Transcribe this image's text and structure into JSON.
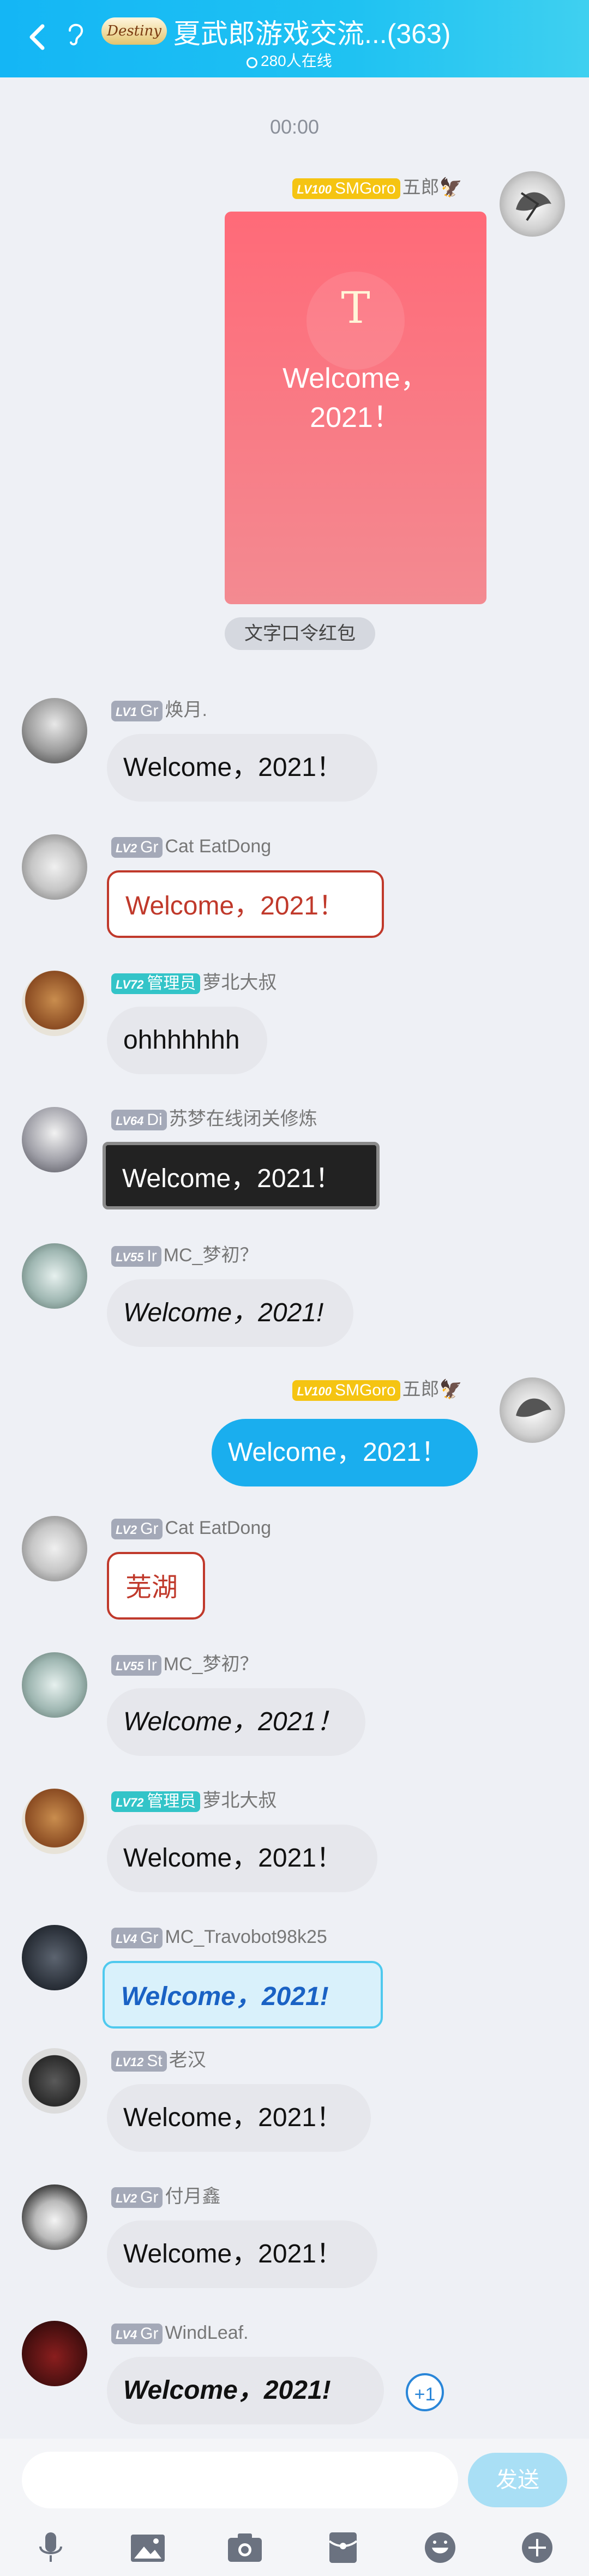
{
  "header": {
    "group_logo_text": "Destiny",
    "title": "夏武郎游戏交流...(363)",
    "online": "280人在线"
  },
  "time": "00:00",
  "owner_message": {
    "level": "LV100",
    "title_badge": "SMGoro",
    "name": "五郎",
    "envelope_icon_text": "T",
    "envelope_text_line1": "Welcome，",
    "envelope_text_line2": "2021！",
    "envelope_label": "文字口令红包"
  },
  "messages": [
    {
      "level": "LV1",
      "tag": "Gr",
      "name": "焕月.",
      "text": "Welcome，2021！"
    },
    {
      "level": "LV2",
      "tag": "Gr",
      "name": "Cat EatDong",
      "text": "Welcome，2021！"
    },
    {
      "level": "LV72",
      "tag": "管理员",
      "name": "萝北大叔",
      "text": "ohhhhhhh"
    },
    {
      "level": "LV64",
      "tag": "Di",
      "name": "苏梦在线闭关修炼",
      "text": "Welcome，2021！"
    },
    {
      "level": "LV55",
      "tag": "Ir",
      "name": "MC_梦初？",
      "text": "Welcome，2021!"
    },
    {
      "level": "LV100",
      "tag": "SMGoro",
      "name": "五郎",
      "text": "Welcome，2021！"
    },
    {
      "level": "LV2",
      "tag": "Gr",
      "name": "Cat EatDong",
      "text": "芜湖"
    },
    {
      "level": "LV55",
      "tag": "Ir",
      "name": "MC_梦初？",
      "text": "Welcome，2021！"
    },
    {
      "level": "LV72",
      "tag": "管理员",
      "name": "萝北大叔",
      "text": "Welcome，2021！"
    },
    {
      "level": "LV4",
      "tag": "Gr",
      "name": "MC_Travobot98k25",
      "text": "Welcome，2021!"
    },
    {
      "level": "LV12",
      "tag": "St",
      "name": "老汉",
      "text": "Welcome，2021！"
    },
    {
      "level": "LV2",
      "tag": "Gr",
      "name": "付月鑫",
      "text": "Welcome，2021！"
    },
    {
      "level": "LV4",
      "tag": "Gr",
      "name": "WindLeaf.",
      "text": "Welcome，2021!"
    }
  ],
  "plus_one": "+1",
  "input": {
    "send_label": "发送",
    "tools": [
      "microphone-icon",
      "image-icon",
      "camera-icon",
      "red-packet-icon",
      "emoji-icon",
      "plus-icon"
    ]
  },
  "colors": {
    "header": "#1fc2f2",
    "self_bubble": "#1aaeee",
    "envelope": "#ff6a78"
  }
}
